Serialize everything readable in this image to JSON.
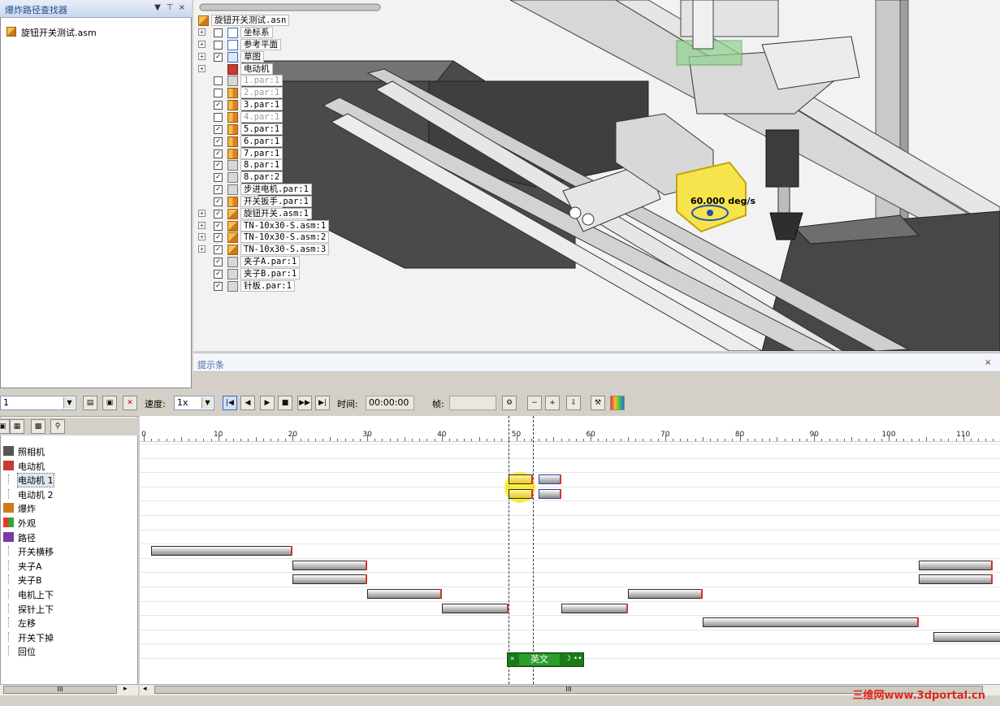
{
  "path_finder": {
    "title": "爆炸路径查找器",
    "header_buttons": [
      "▼",
      "⊤",
      "×"
    ],
    "root_file": "旋钮开关测试.asm"
  },
  "tree": {
    "root": "旋钮开关测试.asn",
    "items": [
      {
        "label": "坐标系",
        "checked": false,
        "expand": true,
        "icon": "coordinate-system-icon",
        "dim": false
      },
      {
        "label": "参考平面",
        "checked": false,
        "expand": true,
        "icon": "reference-plane-icon",
        "dim": false
      },
      {
        "label": "草图",
        "checked": true,
        "expand": true,
        "icon": "sketch-icon",
        "dim": false
      },
      {
        "label": "电动机",
        "checked": null,
        "expand": true,
        "icon": "motor-icon",
        "dim": false
      },
      {
        "label": "1.par:1",
        "checked": false,
        "expand": false,
        "icon": "part-icon",
        "dim": true
      },
      {
        "label": "2.par:1",
        "checked": false,
        "expand": false,
        "icon": "part-yellow-icon",
        "dim": true
      },
      {
        "label": "3.par:1",
        "checked": true,
        "expand": false,
        "icon": "part-yellow-icon",
        "dim": false
      },
      {
        "label": "4.par:1",
        "checked": false,
        "expand": false,
        "icon": "part-yellow-icon",
        "dim": true
      },
      {
        "label": "5.par:1",
        "checked": true,
        "expand": false,
        "icon": "part-yellow-icon",
        "dim": false
      },
      {
        "label": "6.par:1",
        "checked": true,
        "expand": false,
        "icon": "part-yellow-icon",
        "dim": false
      },
      {
        "label": "7.par:1",
        "checked": true,
        "expand": false,
        "icon": "part-yellow-icon",
        "dim": false
      },
      {
        "label": "8.par:1",
        "checked": true,
        "expand": false,
        "icon": "part-icon",
        "dim": false
      },
      {
        "label": "8.par:2",
        "checked": true,
        "expand": false,
        "icon": "part-icon",
        "dim": false
      },
      {
        "label": "步进电机.par:1",
        "checked": true,
        "expand": false,
        "icon": "part-icon",
        "dim": false
      },
      {
        "label": "开关扳手.par:1",
        "checked": true,
        "expand": false,
        "icon": "part-yellow-icon",
        "dim": false
      },
      {
        "label": "旋钮开关.asm:1",
        "checked": true,
        "expand": true,
        "icon": "assembly-icon",
        "dim": false
      },
      {
        "label": "TN-10x30-S.asm:1",
        "checked": true,
        "expand": true,
        "icon": "assembly-icon",
        "dim": false
      },
      {
        "label": "TN-10x30-S.asm:2",
        "checked": true,
        "expand": true,
        "icon": "assembly-icon",
        "dim": false
      },
      {
        "label": "TN-10x30-S.asm:3",
        "checked": true,
        "expand": true,
        "icon": "assembly-icon",
        "dim": false
      },
      {
        "label": "夹子A.par:1",
        "checked": true,
        "expand": false,
        "icon": "part-icon",
        "dim": false
      },
      {
        "label": "夹子B.par:1",
        "checked": true,
        "expand": false,
        "icon": "part-icon",
        "dim": false
      },
      {
        "label": "针板.par:1",
        "checked": true,
        "expand": false,
        "icon": "part-icon",
        "dim": false
      }
    ]
  },
  "viewport": {
    "rotation_label": "60.000 deg/s"
  },
  "hint_bar": {
    "label": "提示条",
    "close": "×"
  },
  "toolbar": {
    "animation_select": "1",
    "speed_label": "速度:",
    "speed_value": "1x",
    "time_label": "时间:",
    "time_value": "00:00:00",
    "frame_label": "帧:",
    "frame_value": ""
  },
  "timeline": {
    "ruler_ticks": [
      "0",
      "10",
      "20",
      "30",
      "40",
      "50",
      "60",
      "70",
      "80",
      "90",
      "100",
      "110"
    ],
    "tracks": [
      {
        "label": "照相机",
        "indent": false,
        "icon": "camera-icon"
      },
      {
        "label": "电动机",
        "indent": false,
        "icon": "motor-icon"
      },
      {
        "label": "电动机 1",
        "indent": true,
        "icon": "",
        "selected": true
      },
      {
        "label": "电动机 2",
        "indent": true,
        "icon": ""
      },
      {
        "label": "爆炸",
        "indent": false,
        "icon": "explode-icon"
      },
      {
        "label": "外观",
        "indent": false,
        "icon": "appearance-icon"
      },
      {
        "label": "路径",
        "indent": false,
        "icon": "path-icon"
      },
      {
        "label": "开关横移",
        "indent": true,
        "icon": ""
      },
      {
        "label": "夹子A",
        "indent": true,
        "icon": ""
      },
      {
        "label": "夹子B",
        "indent": true,
        "icon": ""
      },
      {
        "label": "电机上下",
        "indent": true,
        "icon": ""
      },
      {
        "label": "探针上下",
        "indent": true,
        "icon": ""
      },
      {
        "label": "左移",
        "indent": true,
        "icon": ""
      },
      {
        "label": "开关下掉",
        "indent": true,
        "icon": ""
      },
      {
        "label": "回位",
        "indent": true,
        "icon": ""
      }
    ],
    "bars": [
      {
        "track": 2,
        "start": 49.0,
        "end": 52.2,
        "style": "yellow"
      },
      {
        "track": 2,
        "start": 53.0,
        "end": 56.0,
        "style": "blue"
      },
      {
        "track": 3,
        "start": 49.0,
        "end": 52.2,
        "style": "yellow"
      },
      {
        "track": 3,
        "start": 53.0,
        "end": 56.0,
        "style": "blue"
      },
      {
        "track": 7,
        "start": 1.0,
        "end": 20.0,
        "style": "grey"
      },
      {
        "track": 8,
        "start": 20.0,
        "end": 30.0,
        "style": "grey"
      },
      {
        "track": 8,
        "start": 104.0,
        "end": 114.0,
        "style": "grey"
      },
      {
        "track": 9,
        "start": 20.0,
        "end": 30.0,
        "style": "grey"
      },
      {
        "track": 9,
        "start": 104.0,
        "end": 114.0,
        "style": "grey"
      },
      {
        "track": 10,
        "start": 30.0,
        "end": 40.0,
        "style": "grey"
      },
      {
        "track": 10,
        "start": 65.0,
        "end": 75.0,
        "style": "grey"
      },
      {
        "track": 11,
        "start": 40.0,
        "end": 49.0,
        "style": "grey"
      },
      {
        "track": 11,
        "start": 56.0,
        "end": 65.0,
        "style": "grey"
      },
      {
        "track": 12,
        "start": 75.0,
        "end": 104.0,
        "style": "grey"
      },
      {
        "track": 13,
        "start": 106.0,
        "end": 116.0,
        "style": "grey"
      }
    ],
    "markers": [
      49.0,
      52.2
    ],
    "popup_label": "英文",
    "scroll_label": "III"
  },
  "watermark": "三维网www.3dportal.cn"
}
